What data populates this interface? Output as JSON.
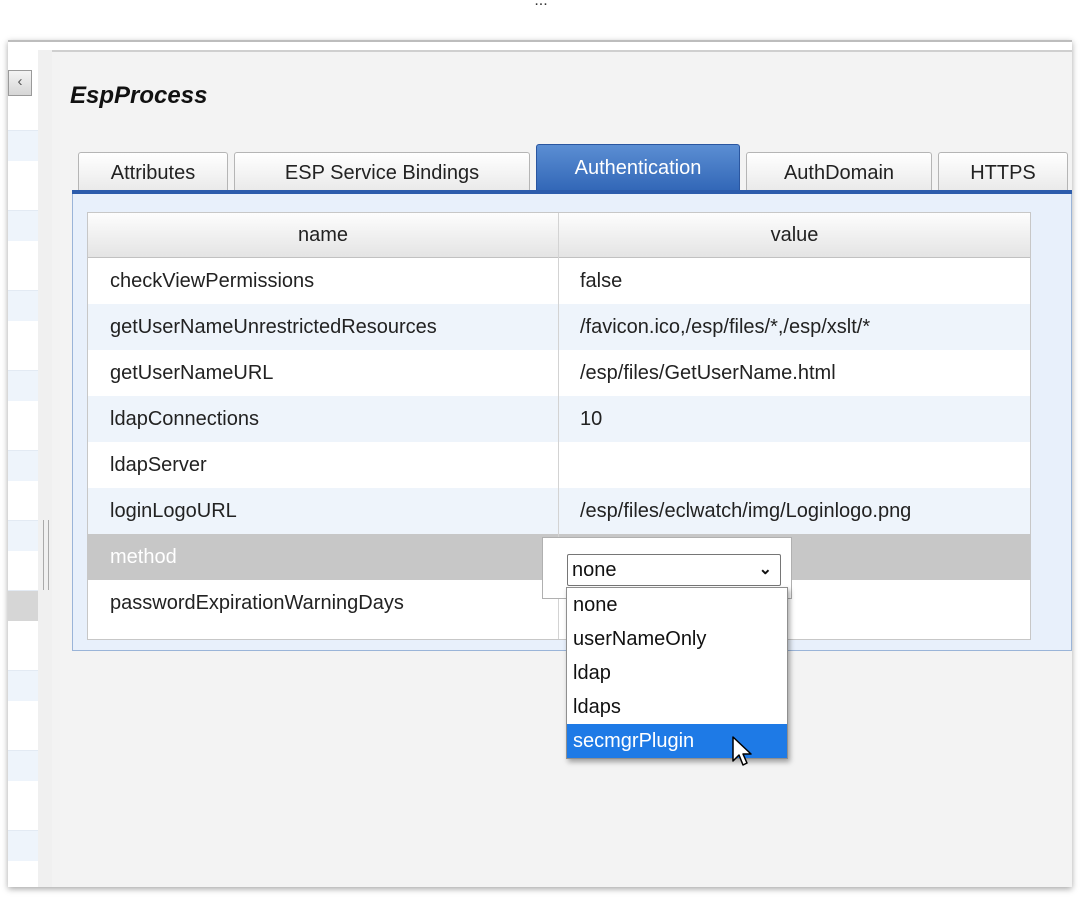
{
  "caption": "...",
  "panel": {
    "title": "EspProcess",
    "collapse_label": "‹"
  },
  "tabs": [
    {
      "label": "Attributes",
      "active": false
    },
    {
      "label": "ESP Service Bindings",
      "active": false
    },
    {
      "label": "Authentication",
      "active": true
    },
    {
      "label": "AuthDomain",
      "active": false
    },
    {
      "label": "HTTPS",
      "active": false
    }
  ],
  "grid": {
    "columns": [
      "name",
      "value"
    ],
    "rows": [
      {
        "name": "checkViewPermissions",
        "value": "false"
      },
      {
        "name": "getUserNameUnrestrictedResources",
        "value": "/favicon.ico,/esp/files/*,/esp/xslt/*"
      },
      {
        "name": "getUserNameURL",
        "value": "/esp/files/GetUserName.html"
      },
      {
        "name": "ldapConnections",
        "value": "10"
      },
      {
        "name": "ldapServer",
        "value": ""
      },
      {
        "name": "loginLogoURL",
        "value": "/esp/files/eclwatch/img/Loginlogo.png"
      },
      {
        "name": "method",
        "value": "none"
      },
      {
        "name": "passwordExpirationWarningDays",
        "value": ""
      }
    ],
    "selected_row": "method"
  },
  "method_select": {
    "selected": "none",
    "options": [
      "none",
      "userNameOnly",
      "ldap",
      "ldaps",
      "secmgrPlugin"
    ],
    "highlighted": "secmgrPlugin"
  },
  "colors": {
    "active_tab": "#2f64b5",
    "row_alt": "#eef4fb",
    "row_selected": "#c7c7c7",
    "option_highlight": "#1e7ae6"
  }
}
